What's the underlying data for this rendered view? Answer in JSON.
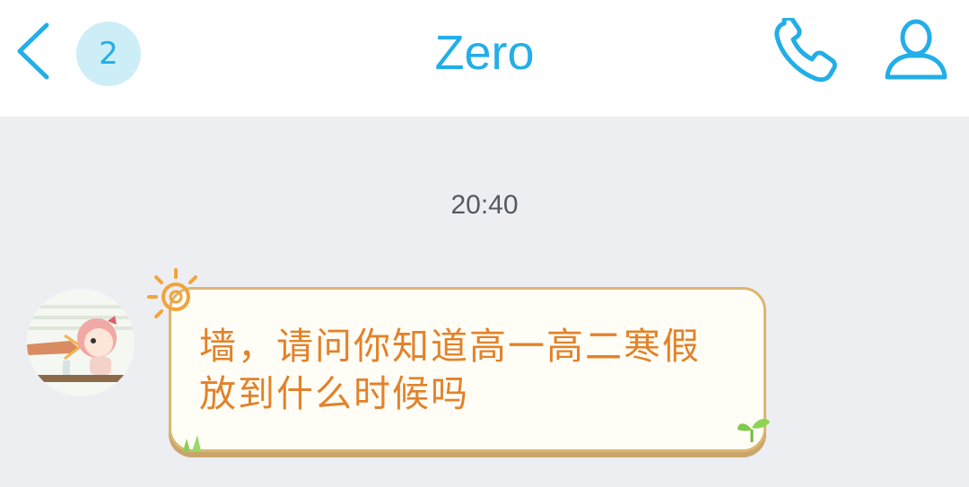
{
  "header": {
    "back_icon": "chevron-left-icon",
    "unread_count": "2",
    "title": "Zero",
    "call_icon": "phone-icon",
    "profile_icon": "user-icon"
  },
  "chat": {
    "timestamp": "20:40",
    "messages": [
      {
        "sender_avatar": "avatar-cartoon-girl",
        "text": "墙，请问你知道高一高二寒假放到什么时候吗"
      }
    ]
  },
  "colors": {
    "accent": "#22aee8",
    "badge_bg": "#cdeef7",
    "background": "#eceef2",
    "bubble_text": "#e2822b",
    "bubble_border": "#dcb66e"
  }
}
